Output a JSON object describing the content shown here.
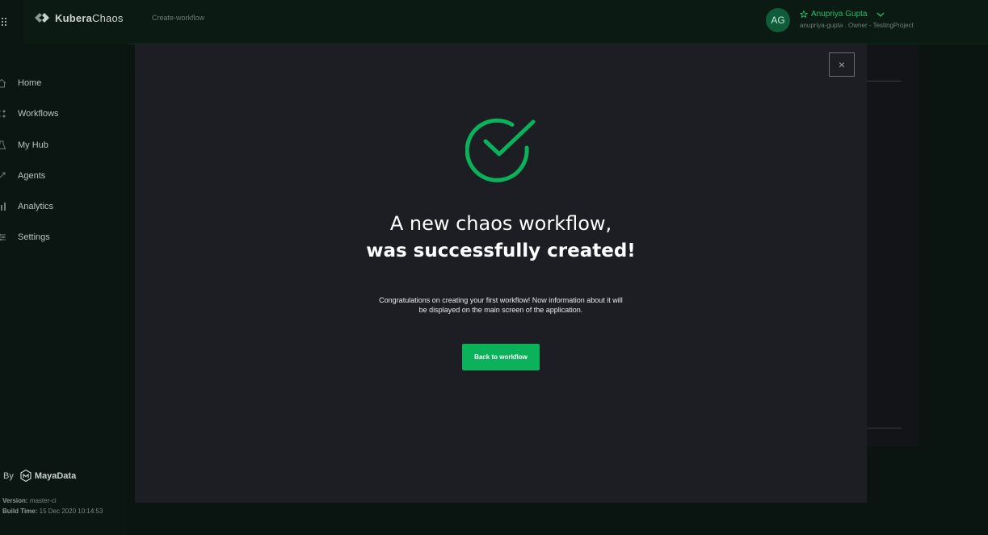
{
  "header": {
    "brand_strong": "Kubera",
    "brand_light": "Chaos",
    "breadcrumb": "Create-workflow",
    "user": {
      "initials": "AG",
      "name": "Anupriya Gupta",
      "meta": "anupriya-gupta . Owner - TestingProject"
    }
  },
  "sidebar": {
    "items": [
      {
        "label": "Home",
        "icon": "home-icon"
      },
      {
        "label": "Workflows",
        "icon": "workflows-icon"
      },
      {
        "label": "My Hub",
        "icon": "hub-icon"
      },
      {
        "label": "Agents",
        "icon": "agents-icon"
      },
      {
        "label": "Analytics",
        "icon": "analytics-icon"
      },
      {
        "label": "Settings",
        "icon": "settings-icon"
      }
    ],
    "by_label": "By",
    "company": "MayaData",
    "version_label": "Version:",
    "version_value": "master-ci",
    "build_label": "Build Time:",
    "build_value": "15 Dec 2020 10:14:53"
  },
  "modal": {
    "close_glyph": "×",
    "headline": "A new chaos workflow,",
    "headline_bold": "was successfully created!",
    "description": "Congratulations on creating your first workflow! Now information about it will be displayed on the main screen of the application.",
    "back_button": "Back to workflow"
  },
  "colors": {
    "accent": "#0ab35a",
    "modal_bg": "#1c1e24",
    "page_bg": "#0a1511"
  }
}
